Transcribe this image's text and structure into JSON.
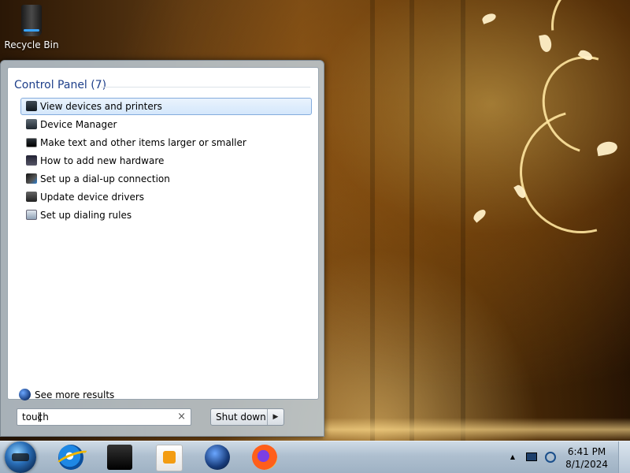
{
  "desktop": {
    "icons": [
      {
        "label": "Recycle Bin",
        "icon": "recycle-bin-icon"
      }
    ]
  },
  "start_menu": {
    "group_title": "Control Panel (7)",
    "results": [
      {
        "label": "View devices and printers",
        "icon": "printer-icon",
        "selected": true
      },
      {
        "label": "Device Manager",
        "icon": "device-manager-icon"
      },
      {
        "label": "Make text and other items larger or smaller",
        "icon": "display-icon"
      },
      {
        "label": "How to add new hardware",
        "icon": "hardware-icon"
      },
      {
        "label": "Set up a dial-up connection",
        "icon": "dialup-icon"
      },
      {
        "label": "Update device drivers",
        "icon": "driver-icon"
      },
      {
        "label": "Set up dialing rules",
        "icon": "dialing-rules-icon"
      }
    ],
    "see_more": "See more results",
    "search": {
      "value": "touch",
      "clear_glyph": "×"
    },
    "shutdown": {
      "label": "Shut down",
      "arrow": "▶"
    }
  },
  "taskbar": {
    "pinned": [
      "internet-explorer-icon",
      "devices-printers-icon",
      "media-player-icon",
      "network-globe-icon",
      "firefox-icon"
    ],
    "tray": {
      "up_glyph": "▲"
    },
    "clock": {
      "time": "6:41 PM",
      "date": "8/1/2024"
    }
  }
}
